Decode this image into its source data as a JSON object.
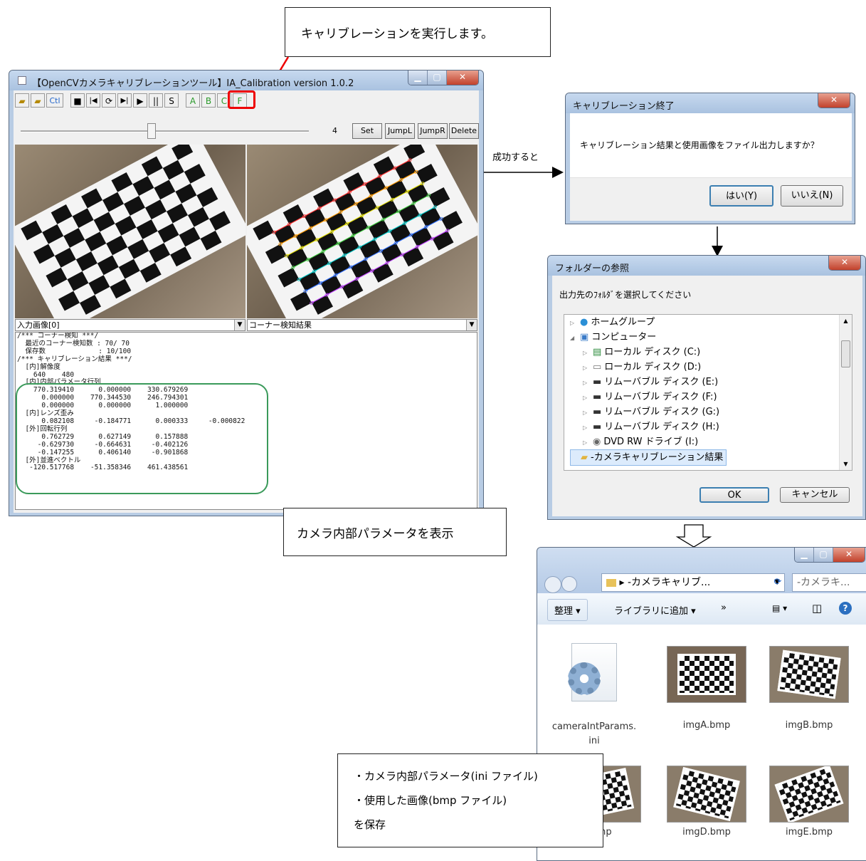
{
  "callouts": {
    "run_calibration": "キャリブレーションを実行します。",
    "show_params": "カメラ内部パラメータを表示",
    "save_line1": "・カメラ内部パラメータ(ini ファイル)",
    "save_line2": "・使用した画像(bmp ファイル)",
    "save_line3": "を保存",
    "success": "成功すると"
  },
  "main_window": {
    "title": "【OpenCVカメラキャリブレーションツール】IA_Calibration version 1.0.2",
    "toolbar": [
      "Ctl",
      "■",
      "|◀",
      "⟳",
      "▶|",
      "▶",
      "||",
      "S",
      "A",
      "B",
      "C",
      "F"
    ],
    "slider_value": "4",
    "slider_level": 0.45,
    "buttons": {
      "set": "Set",
      "jumpl": "JumpL",
      "jumpr": "JumpR",
      "delete": "Delete"
    },
    "left_combo": "入力画像[0]",
    "right_combo": "コーナー検知結果",
    "log_lines": [
      "/*** コーナー検知 ***/",
      "  最近のコーナー検知数 : 70/ 70",
      "  保存数             : 10/100",
      "/*** キャリブレーション結果 ***/",
      "  [内]解像度",
      "    640    480",
      "  [内]内部パラメータ行列",
      "    770.319410      0.000000    330.679269",
      "      0.000000    770.344530    246.794301",
      "      0.000000      0.000000      1.000000",
      "  [内]レンズ歪み",
      "      0.082108     -0.184771      0.000333     -0.000822",
      "  [外]回転行列",
      "      0.762729      0.627149      0.157888",
      "     -0.629730     -0.664631     -0.402126",
      "     -0.147255      0.406140     -0.901868",
      "  [外]並進ベクトル",
      "   -120.517768    -51.358346    461.438561"
    ]
  },
  "dialog_end": {
    "title": "キャリブレーション終了",
    "message": "キャリブレーション結果と使用画像をファイル出力しますか？",
    "yes": "はい(Y)",
    "no": "いいえ(N)"
  },
  "folder_dialog": {
    "title": "フォルダーの参照",
    "prompt": "出力先のﾌｫﾙﾀﾞを選択してください",
    "tree": [
      "ホームグループ",
      "コンピューター",
      "ローカル ディスク (C:)",
      "ローカル ディスク (D:)",
      "リムーバブル ディスク (E:)",
      "リムーバブル ディスク (F:)",
      "リムーバブル ディスク (G:)",
      "リムーバブル ディスク (H:)",
      "DVD RW ドライブ (I:)",
      "-カメラキャリブレーション結果"
    ],
    "ok": "OK",
    "cancel": "キャンセル"
  },
  "explorer": {
    "breadcrumb": "-カメラキャリブ...",
    "search": "-カメラキ...",
    "organize": "整理 ▾",
    "add_library": "ライブラリに追加 ▾",
    "more": "»",
    "files": [
      "cameraIntParams.ini",
      "imgA.bmp",
      "imgB.bmp",
      "bmp",
      "imgD.bmp",
      "imgE.bmp"
    ]
  }
}
